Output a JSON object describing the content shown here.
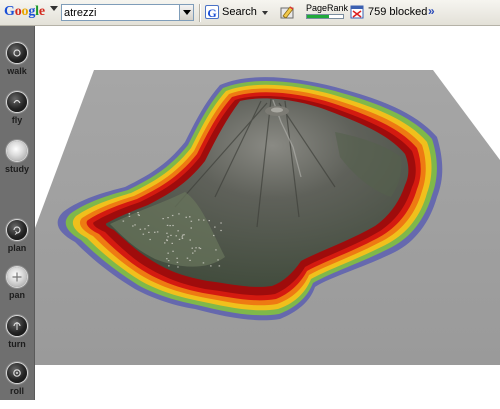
{
  "toolbar": {
    "logo": {
      "g1": "G",
      "o1": "o",
      "o2": "o",
      "g2": "g",
      "l": "l",
      "e": "e"
    },
    "search_value": "atrezzi",
    "search_label": "Search",
    "pagerank_label": "PageRank",
    "pagerank_fraction": 0.6,
    "blocked_label": "759 blocked",
    "more_label": "»"
  },
  "nav": {
    "items": [
      {
        "label": "walk",
        "active": false
      },
      {
        "label": "fly",
        "active": false
      },
      {
        "label": "study",
        "active": true
      },
      {
        "label": "plan",
        "active": false
      },
      {
        "label": "pan",
        "active": false
      },
      {
        "label": "turn",
        "active": false
      },
      {
        "label": "roll",
        "active": false
      }
    ]
  },
  "view": {
    "plane_color": "#a0a0a0",
    "terrain_color": "#55574f",
    "hazard_colors": [
      "#9f0c0c",
      "#d41a10",
      "#ee7a12",
      "#f0c01c",
      "#7fb84a",
      "#5c5fb0"
    ]
  }
}
